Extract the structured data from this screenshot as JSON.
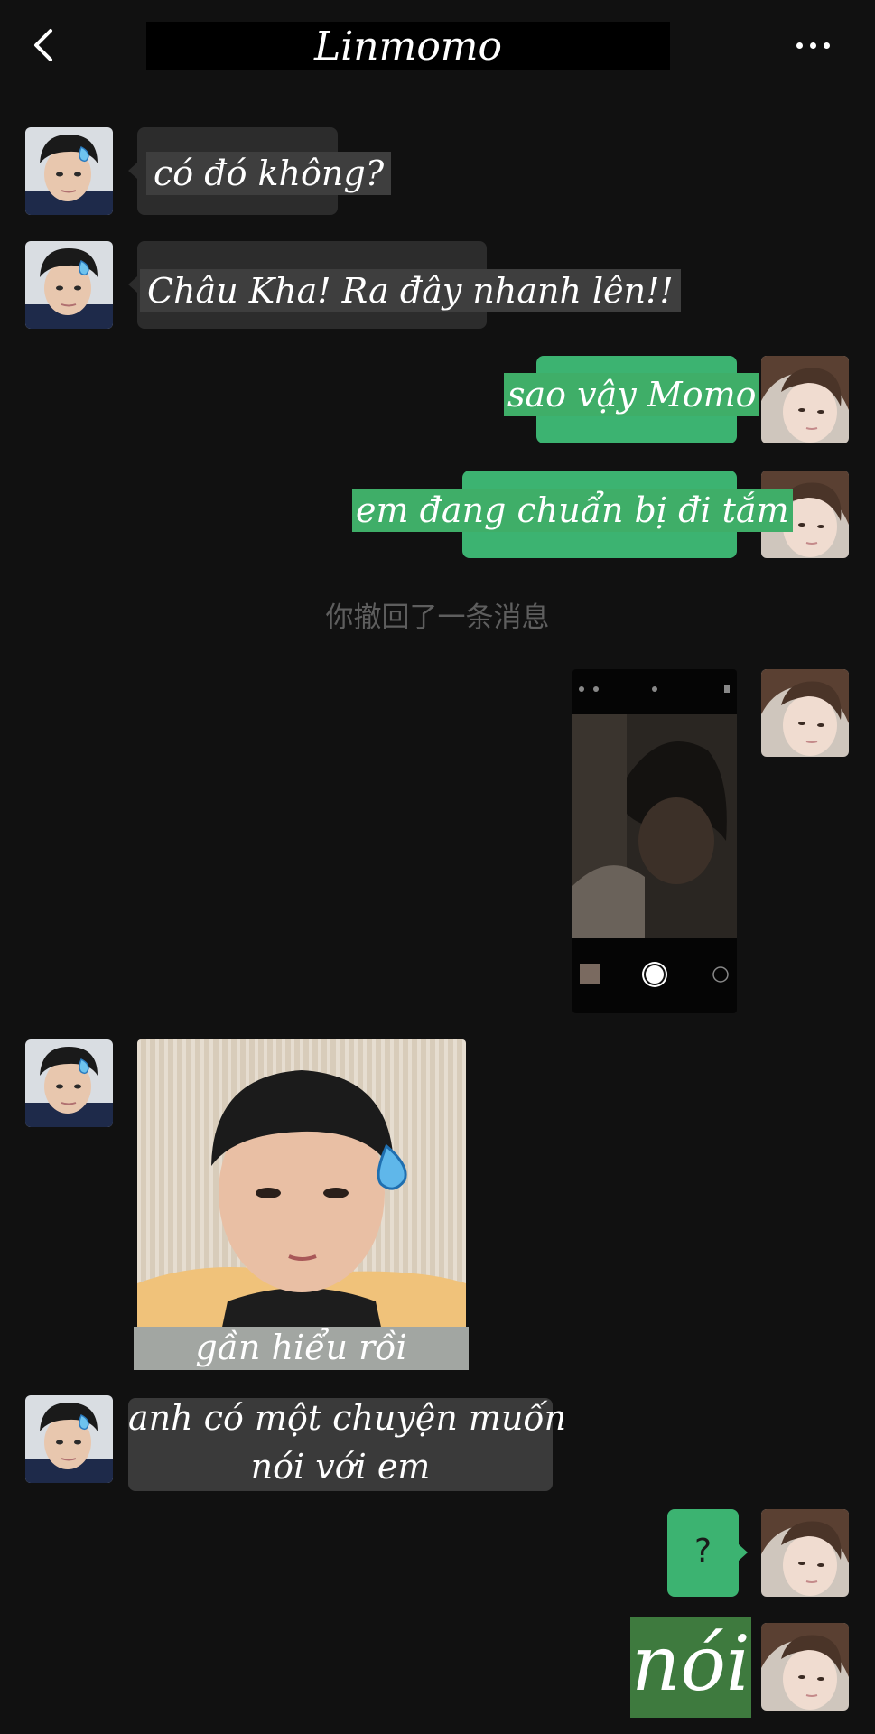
{
  "header": {
    "title": "Linmomo",
    "back_icon": "chevron-left-icon",
    "more_icon": "more-horizontal-icon"
  },
  "messages": [
    {
      "side": "left",
      "text": "có đó không?"
    },
    {
      "side": "left",
      "text": "Châu Kha! Ra đây nhanh lên!!"
    },
    {
      "side": "right",
      "text": "sao vậy Momo"
    },
    {
      "side": "right",
      "text": "em đang chuẩn bị đi tắm"
    },
    {
      "side": "system",
      "text": "你撤回了一条消息"
    },
    {
      "side": "right",
      "type": "image",
      "description": "camera screenshot"
    },
    {
      "side": "left",
      "type": "sticker",
      "caption": "gần hiểu rồi"
    },
    {
      "side": "left",
      "text_line1": "anh có một chuyện muốn",
      "text_line2": "nói với em"
    },
    {
      "side": "right",
      "text": "?"
    },
    {
      "side": "right",
      "text": "nói"
    }
  ],
  "colors": {
    "background": "#111111",
    "bubble_gray": "#2c2c2c",
    "bubble_green": "#3cb371",
    "system_text": "#5e5e5e"
  }
}
